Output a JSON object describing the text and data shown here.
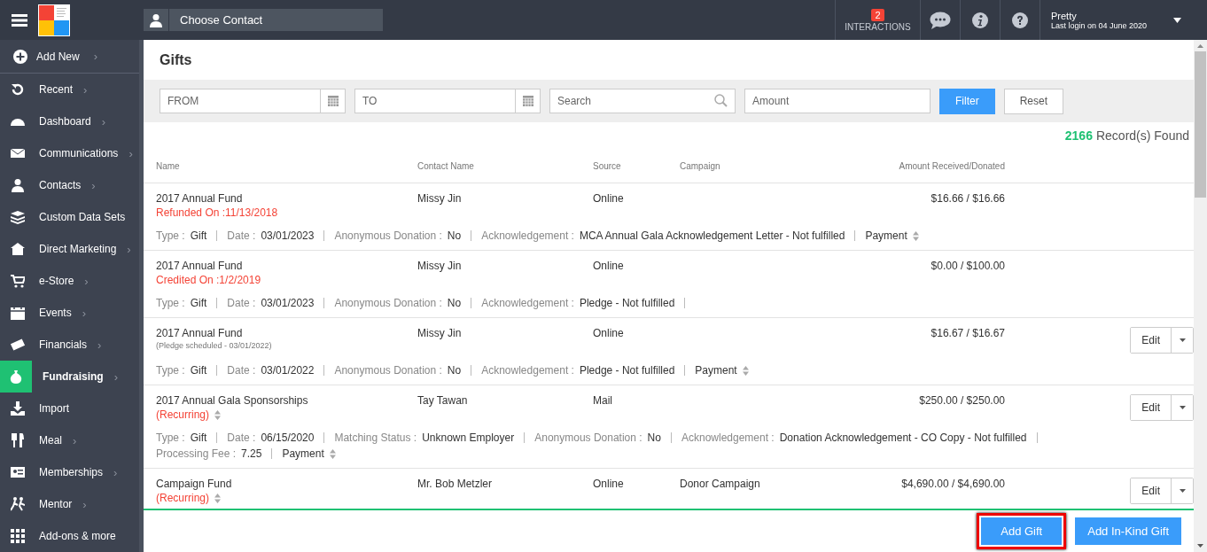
{
  "topbar": {
    "contact_picker": {
      "placeholder": "Choose Contact"
    },
    "interactions": {
      "label": "INTERACTIONS",
      "badge": "2"
    },
    "user": {
      "name": "Pretty",
      "last_login": "Last login on 04 June 2020"
    }
  },
  "sidebar": {
    "add_new": {
      "label": "Add New",
      "chevron": "›"
    },
    "items": [
      {
        "label": "Recent",
        "chevron": "›",
        "selected": false
      },
      {
        "label": "Dashboard",
        "chevron": "›",
        "selected": false
      },
      {
        "label": "Communications",
        "chevron": "›",
        "selected": false
      },
      {
        "label": "Contacts",
        "chevron": "›",
        "selected": false
      },
      {
        "label": "Custom Data Sets",
        "selected": false
      },
      {
        "label": "Direct Marketing",
        "chevron": "›",
        "selected": false
      },
      {
        "label": "e-Store",
        "chevron": "›",
        "selected": false
      },
      {
        "label": "Events",
        "chevron": "›",
        "selected": false
      },
      {
        "label": "Financials",
        "chevron": "›",
        "selected": false
      },
      {
        "label": "Fundraising",
        "chevron": "›",
        "selected": true
      },
      {
        "label": "Import",
        "selected": false
      },
      {
        "label": "Meal",
        "chevron": "›",
        "selected": false
      },
      {
        "label": "Memberships",
        "chevron": "›",
        "selected": false
      },
      {
        "label": "Mentor",
        "chevron": "›",
        "selected": false
      },
      {
        "label": "Add-ons & more",
        "selected": false
      }
    ]
  },
  "page": {
    "title": "Gifts"
  },
  "filters": {
    "from": {
      "placeholder": "FROM"
    },
    "to": {
      "placeholder": "TO"
    },
    "search": {
      "placeholder": "Search"
    },
    "amount": {
      "placeholder": "Amount"
    },
    "buttons": [
      "Filter",
      "Reset"
    ]
  },
  "summary": {
    "count": "2166",
    "label": "Record(s) Found"
  },
  "table": {
    "columns": [
      "Name",
      "Contact Name",
      "Source",
      "Campaign",
      "Amount Received/Donated"
    ],
    "rows": [
      {
        "name": "2017 Annual Fund",
        "note": {
          "kind": "refund",
          "text": "Refunded On :11/13/2018"
        },
        "contact": "Missy Jin",
        "source": "Online",
        "amount": "$16.66 / $16.66",
        "details": [
          {
            "label": "Type :",
            "value": "Gift"
          },
          {
            "label": "Date :",
            "value": "03/01/2023"
          },
          {
            "label": "Anonymous Donation :",
            "value": "No"
          },
          {
            "label": "Acknowledgement :",
            "value": "MCA Annual Gala Acknowledgement Letter - Not fulfilled"
          },
          {
            "value": "Payment",
            "sortable": true
          }
        ]
      },
      {
        "name": "2017 Annual Fund",
        "note": {
          "kind": "refund",
          "text": "Credited On :1/2/2019"
        },
        "contact": "Missy Jin",
        "source": "Online",
        "amount": "$0.00 / $100.00",
        "trailing_separator": true,
        "details": [
          {
            "label": "Type :",
            "value": "Gift"
          },
          {
            "label": "Date :",
            "value": "03/01/2023"
          },
          {
            "label": "Anonymous Donation :",
            "value": "No"
          },
          {
            "label": "Acknowledgement :",
            "value": "Pledge - Not fulfilled"
          }
        ]
      },
      {
        "name": "2017 Annual Fund",
        "note": {
          "kind": "pledge",
          "text": "(Pledge scheduled - 03/01/2022)"
        },
        "contact": "Missy Jin",
        "source": "Online",
        "amount": "$16.67 / $16.67",
        "edit_label": "Edit",
        "details": [
          {
            "label": "Type :",
            "value": "Gift"
          },
          {
            "label": "Date :",
            "value": "03/01/2022"
          },
          {
            "label": "Anonymous Donation :",
            "value": "No"
          },
          {
            "label": "Acknowledgement :",
            "value": "Pledge - Not fulfilled"
          },
          {
            "value": "Payment",
            "sortable": true
          }
        ]
      },
      {
        "name": "2017 Annual Gala Sponsorships",
        "note": {
          "kind": "recurring",
          "text": "(Recurring)"
        },
        "contact": "Tay Tawan",
        "source": "Mail",
        "amount": "$250.00 / $250.00",
        "edit_label": "Edit",
        "details": [
          {
            "label": "Type :",
            "value": "Gift"
          },
          {
            "label": "Date :",
            "value": "06/15/2020"
          },
          {
            "label": "Matching Status :",
            "value": "Unknown Employer"
          },
          {
            "label": "Anonymous Donation :",
            "value": "No"
          },
          {
            "label": "Acknowledgement :",
            "value": "Donation Acknowledgement - CO Copy - Not fulfilled"
          },
          {
            "label": "Processing Fee :",
            "value": "7.25"
          },
          {
            "value": "Payment",
            "sortable": true
          }
        ]
      },
      {
        "name": "Campaign Fund",
        "note": {
          "kind": "recurring",
          "text": "(Recurring)"
        },
        "contact": "Mr. Bob Metzler",
        "source": "Online",
        "campaign": "Donor Campaign",
        "amount": "$4,690.00 / $4,690.00",
        "edit_label": "Edit",
        "details": []
      }
    ]
  },
  "footer": {
    "buttons": [
      {
        "label": "Add Gift",
        "highlighted": true
      },
      {
        "label": "Add In-Kind Gift",
        "highlighted": false
      }
    ]
  }
}
